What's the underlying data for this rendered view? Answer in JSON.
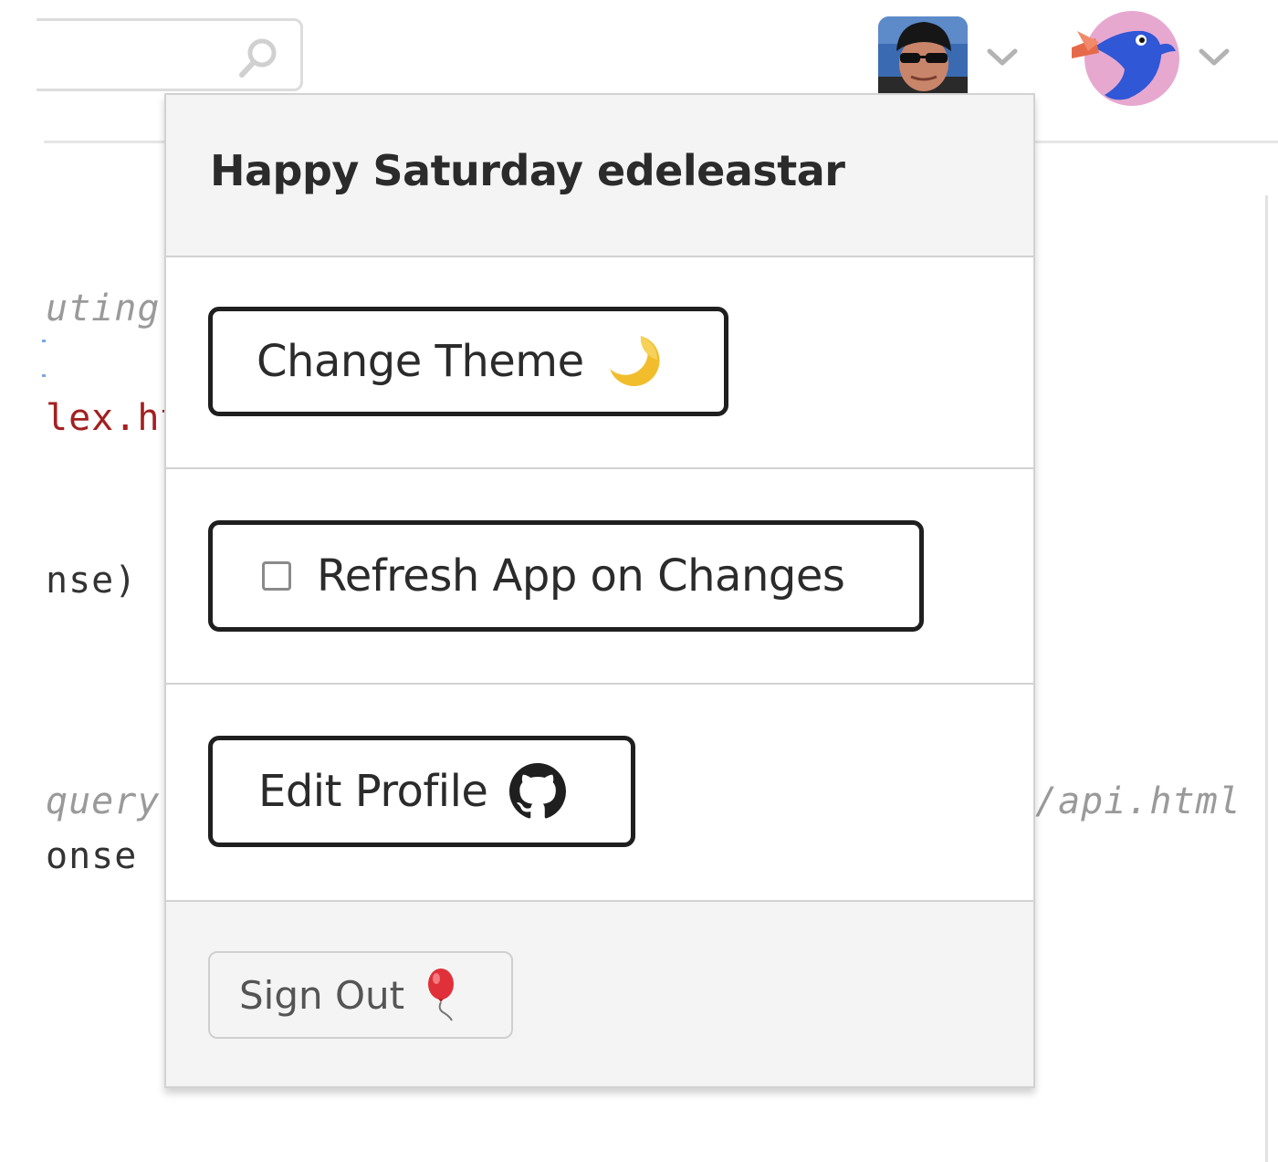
{
  "background_code": {
    "line1": "uting",
    "line2": "lex.ht",
    "line3": "nse)",
    "line4": "query",
    "line5": "onse",
    "line6": "/api.html"
  },
  "dropdown": {
    "greeting": "Happy Saturday edeleastar",
    "change_theme_label": "Change Theme",
    "refresh_label": "Refresh App on Changes",
    "refresh_checked": false,
    "edit_profile_label": "Edit Profile",
    "sign_out_label": "Sign Out"
  },
  "icons": {
    "search": "search-icon",
    "theme": "crescent-moon-icon",
    "profile": "github-icon",
    "sign_out": "balloon-icon",
    "user_menu": "chevron-down-icon",
    "app_menu": "chevron-down-icon"
  },
  "colors": {
    "moon": "#f2bd2c",
    "balloon": "#e0313a",
    "bird_bg": "#e7a8cf",
    "bird_body": "#2f57d6"
  }
}
